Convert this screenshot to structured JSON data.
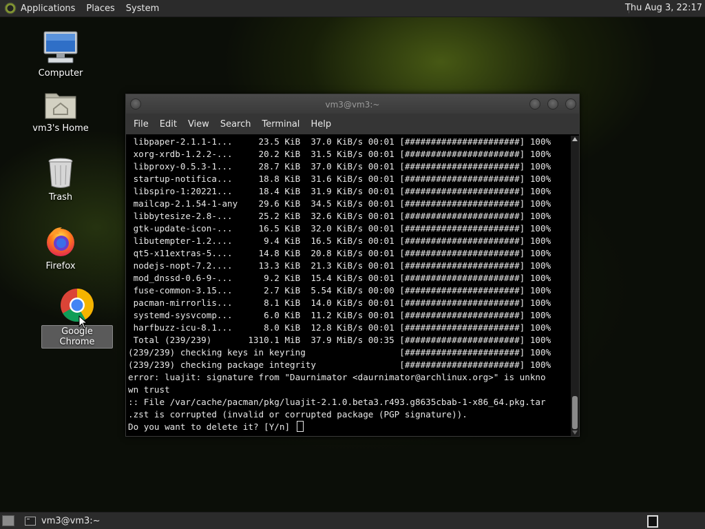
{
  "top_panel": {
    "menus": [
      "Applications",
      "Places",
      "System"
    ],
    "clock": "Thu Aug  3, 22:17"
  },
  "desktop_icons": [
    {
      "label": "Computer"
    },
    {
      "label": "vm3's Home"
    },
    {
      "label": "Trash"
    },
    {
      "label": "Firefox"
    },
    {
      "label": "Google Chrome"
    }
  ],
  "window": {
    "title": "vm3@vm3:~",
    "menu": [
      "File",
      "Edit",
      "View",
      "Search",
      "Terminal",
      "Help"
    ]
  },
  "terminal": {
    "lines": [
      " libpaper-2.1.1-1...     23.5 KiB  37.0 KiB/s 00:01 [######################] 100%",
      " xorg-xrdb-1.2.2-...     20.2 KiB  31.5 KiB/s 00:01 [######################] 100%",
      " libproxy-0.5.3-1...     28.7 KiB  37.0 KiB/s 00:01 [######################] 100%",
      " startup-notifica...     18.8 KiB  31.6 KiB/s 00:01 [######################] 100%",
      " libspiro-1:20221...     18.4 KiB  31.9 KiB/s 00:01 [######################] 100%",
      " mailcap-2.1.54-1-any    29.6 KiB  34.5 KiB/s 00:01 [######################] 100%",
      " libbytesize-2.8-...     25.2 KiB  32.6 KiB/s 00:01 [######################] 100%",
      " gtk-update-icon-...     16.5 KiB  32.0 KiB/s 00:01 [######################] 100%",
      " libutempter-1.2....      9.4 KiB  16.5 KiB/s 00:01 [######################] 100%",
      " qt5-x11extras-5....     14.8 KiB  20.8 KiB/s 00:01 [######################] 100%",
      " nodejs-nopt-7.2....     13.3 KiB  21.3 KiB/s 00:01 [######################] 100%",
      " mod_dnssd-0.6-9-...      9.2 KiB  15.4 KiB/s 00:01 [######################] 100%",
      " fuse-common-3.15...      2.7 KiB  5.54 KiB/s 00:00 [######################] 100%",
      " pacman-mirrorlis...      8.1 KiB  14.0 KiB/s 00:01 [######################] 100%",
      " systemd-sysvcomp...      6.0 KiB  11.2 KiB/s 00:01 [######################] 100%",
      " harfbuzz-icu-8.1...      8.0 KiB  12.8 KiB/s 00:01 [######################] 100%",
      " Total (239/239)       1310.1 MiB  37.9 MiB/s 00:35 [######################] 100%",
      "(239/239) checking keys in keyring                  [######################] 100%",
      "(239/239) checking package integrity                [######################] 100%",
      "error: luajit: signature from \"Daurnimator <daurnimator@archlinux.org>\" is unkno",
      "wn trust",
      ":: File /var/cache/pacman/pkg/luajit-2.1.0.beta3.r493.g8635cbab-1-x86_64.pkg.tar",
      ".zst is corrupted (invalid or corrupted package (PGP signature)).",
      "Do you want to delete it? [Y/n] "
    ]
  },
  "bottom_panel": {
    "task_label": "vm3@vm3:~"
  }
}
